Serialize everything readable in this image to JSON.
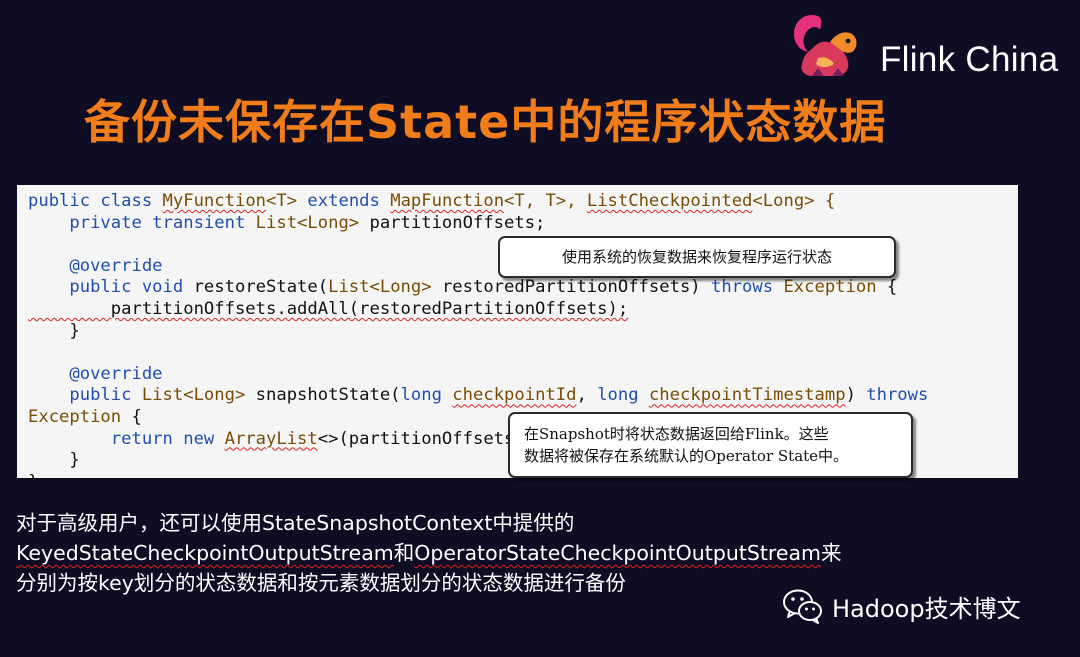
{
  "header": {
    "brand": "Flink China",
    "logo_icon": "squirrel-logo-icon",
    "title": "备份未保存在State中的程序状态数据"
  },
  "code": {
    "line1": {
      "a": "public class ",
      "b": "MyFunction",
      "c": "<T> ",
      "d": "extends ",
      "e": "MapFunction",
      "f": "<T, T>, ",
      "g": "ListCheckpointed",
      "h": "<Long> {"
    },
    "line2": {
      "a": "    private transient ",
      "b": "List<Long>",
      "c": " partitionOffsets;"
    },
    "line4": "    @override",
    "line5": {
      "a": "    public void ",
      "b": "restoreState(",
      "c": "List<Long>",
      "d": " restoredPartitionOffsets) ",
      "e": "throws",
      "f": " ",
      "g": "Exception",
      "h": " {"
    },
    "line6": "        partitionOffsets.addAll(restoredPartitionOffsets);",
    "line7": "    }",
    "line9": "    @override",
    "line10": {
      "a": "    public ",
      "b": "List<Long>",
      "c": " snapshotState(",
      "d": "long",
      "e": " ",
      "f": "checkpointId",
      "g": ", ",
      "h": "long",
      "i": " ",
      "j": "checkpointTimestamp",
      "k": ") ",
      "l": "throws"
    },
    "line11": {
      "a": "Exception",
      "b": " {"
    },
    "line12": {
      "a": "        return new ",
      "b": "ArrayList",
      "c": "<>(partitionOffsets);"
    },
    "line13": "    }",
    "line14": "}"
  },
  "callouts": {
    "restore_note": "使用系统的恢复数据来恢复程序运行状态",
    "snapshot_note_line1": "在Snapshot时将状态数据返回给Flink。这些",
    "snapshot_note_line2": "数据将被保存在系统默认的Operator State中。"
  },
  "body": {
    "line1": "对于高级用户，还可以使用StateSnapshotContext中提供的",
    "line2a": "KeyedStateCheckpointOutputStream",
    "line2b": "和",
    "line2c": "OperatorStateCheckpointOutputStream",
    "line2d": "来",
    "line3": "分别为按key划分的状态数据和按元素数据划分的状态数据进行备份"
  },
  "watermark": {
    "icon": "wechat-icon",
    "text": "Hadoop技术博文"
  },
  "colors": {
    "background": "#0e0d24",
    "title": "#f07d1a",
    "keyword": "#1f4fae",
    "type": "#7a4c05",
    "squiggle": "#e02020"
  }
}
